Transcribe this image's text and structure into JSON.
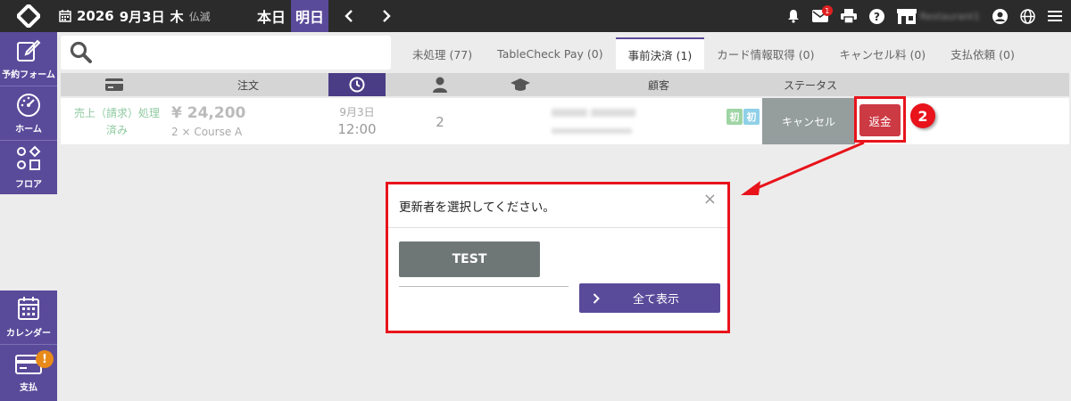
{
  "header": {
    "date_year": "2026",
    "date_md": "9月3日",
    "date_weekday": "木",
    "rokuyo": "仏滅",
    "today_label": "本日",
    "tomorrow_label": "明日",
    "restaurant_name": "Restaurant1",
    "mail_badge": "1"
  },
  "sidebar": {
    "items": [
      {
        "label": "予約フォーム",
        "icon": "edit-icon"
      },
      {
        "label": "ホーム",
        "icon": "gauge-icon"
      },
      {
        "label": "フロア",
        "icon": "shapes-icon"
      },
      {
        "label": "カレンダー",
        "icon": "calendar-icon"
      },
      {
        "label": "支払",
        "icon": "card-icon",
        "badge": "!"
      }
    ]
  },
  "search": {
    "placeholder": "",
    "value": ""
  },
  "tabs": [
    {
      "label": "未処理 (77)",
      "active": false
    },
    {
      "label": "TableCheck Pay (0)",
      "active": false
    },
    {
      "label": "事前決済 (1)",
      "active": true
    },
    {
      "label": "カード情報取得 (0)",
      "active": false
    },
    {
      "label": "キャンセル料 (0)",
      "active": false
    },
    {
      "label": "支払依頼 (0)",
      "active": false
    }
  ],
  "table": {
    "headers": {
      "order": "注文",
      "customer": "顧客",
      "status": "ステータス"
    },
    "rows": [
      {
        "payment_status_line1": "売上（請求）処理",
        "payment_status_line2": "済み",
        "price": "¥ 24,200",
        "course": "2 × Course A",
        "date": "9月3日",
        "time": "12:00",
        "guests": "2",
        "badge1": "初",
        "badge2": "初",
        "status": "キャンセル",
        "refund_label": "返金"
      }
    ]
  },
  "annotation": {
    "step": "2"
  },
  "modal": {
    "title": "更新者を選択してください。",
    "close": "×",
    "user_button": "TEST",
    "show_all": "全て表示"
  },
  "colors": {
    "brand_purple": "#5a4a9a",
    "refund_red": "#cc3a44",
    "highlight_red": "#e8131b",
    "paid_green": "#8fcaa0"
  }
}
